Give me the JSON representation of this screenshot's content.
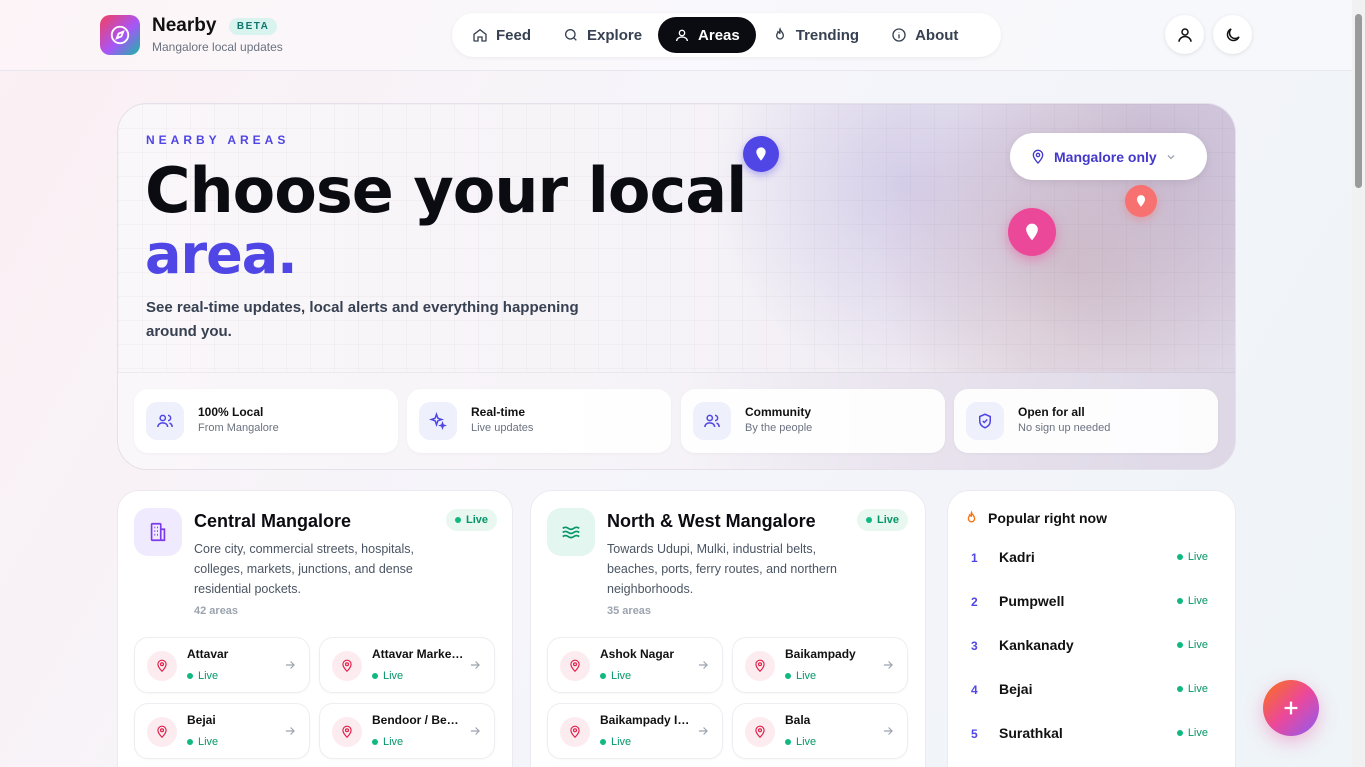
{
  "brand": {
    "title": "Nearby",
    "badge": "BETA",
    "subtitle": "Mangalore local updates"
  },
  "nav": {
    "tabs": [
      {
        "label": "Feed",
        "icon": "home-icon"
      },
      {
        "label": "Explore",
        "icon": "search-icon"
      },
      {
        "label": "Areas",
        "icon": "users-icon",
        "active": true
      },
      {
        "label": "Trending",
        "icon": "flame-icon"
      },
      {
        "label": "About",
        "icon": "info-icon"
      }
    ]
  },
  "header_actions": {
    "profile_icon": "user-icon",
    "theme_icon": "moon-icon"
  },
  "hero": {
    "eyebrow": "NEARBY AREAS",
    "title": "Choose your local",
    "accent": "area.",
    "description": "See real-time updates, local alerts and everything happening around you.",
    "city_select": "Mangalore only",
    "features": [
      {
        "title": "100% Local",
        "subtitle": "From Mangalore",
        "icon": "users-icon"
      },
      {
        "title": "Real-time",
        "subtitle": "Live updates",
        "icon": "sparkles-icon"
      },
      {
        "title": "Community",
        "subtitle": "By the people",
        "icon": "users-icon"
      },
      {
        "title": "Open for all",
        "subtitle": "No sign up needed",
        "icon": "shield-check-icon"
      }
    ]
  },
  "regions": [
    {
      "title": "Central Mangalore",
      "live": "Live",
      "description": "Core city, commercial streets, hospitals, colleges, markets, junctions, and dense residential pockets.",
      "count": "42 areas",
      "icon": "building-icon",
      "areas": [
        {
          "name": "Attavar",
          "status": "Live"
        },
        {
          "name": "Attavar Market Road",
          "status": "Live"
        },
        {
          "name": "Bejai",
          "status": "Live"
        },
        {
          "name": "Bendoor / Bendurwell",
          "status": "Live"
        }
      ]
    },
    {
      "title": "North & West Mangalore",
      "live": "Live",
      "description": "Towards Udupi, Mulki, industrial belts, beaches, ports, ferry routes, and northern neighborhoods.",
      "count": "35 areas",
      "icon": "waves-icon",
      "areas": [
        {
          "name": "Ashok Nagar",
          "status": "Live"
        },
        {
          "name": "Baikampady",
          "status": "Live"
        },
        {
          "name": "Baikampady Industrial Area",
          "status": "Live"
        },
        {
          "name": "Bala",
          "status": "Live"
        }
      ]
    }
  ],
  "popular": {
    "title": "Popular right now",
    "items": [
      {
        "rank": "1",
        "name": "Kadri",
        "status": "Live"
      },
      {
        "rank": "2",
        "name": "Pumpwell",
        "status": "Live"
      },
      {
        "rank": "3",
        "name": "Kankanady",
        "status": "Live"
      },
      {
        "rank": "4",
        "name": "Bejai",
        "status": "Live"
      },
      {
        "rank": "5",
        "name": "Surathkal",
        "status": "Live"
      }
    ]
  },
  "fab": {
    "icon": "plus-icon"
  },
  "colors": {
    "accent": "#4f46e5",
    "live": "#10b981",
    "pin": "#ec4899",
    "dark": "#0b0b12"
  }
}
